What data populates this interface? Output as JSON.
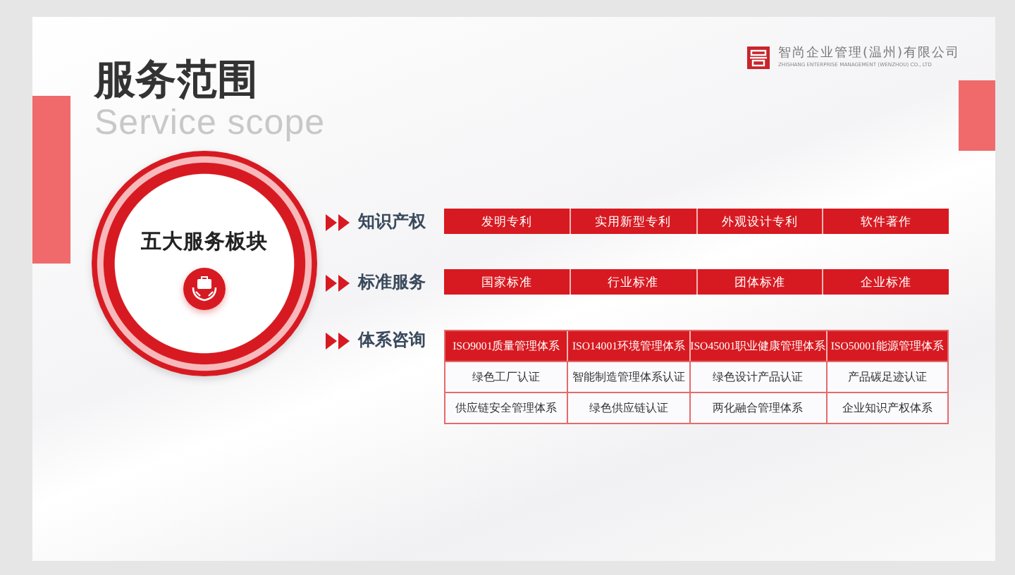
{
  "header": {
    "title": "服务范围",
    "subtitle": "Service scope"
  },
  "company": {
    "name": "智尚企业管理(温州)有限公司",
    "name_en": "ZHISHANG ENTERPRISE MANAGEMENT (WENZHOU) CO., LTD"
  },
  "hub": {
    "label": "五大服务板块"
  },
  "sections": [
    {
      "title": "知识产权",
      "kind": "strip",
      "items": [
        "发明专利",
        "实用新型专利",
        "外观设计专利",
        "软件著作"
      ]
    },
    {
      "title": "标准服务",
      "kind": "strip",
      "items": [
        "国家标准",
        "行业标准",
        "团体标准",
        "企业标准"
      ]
    },
    {
      "title": "体系咨询",
      "kind": "grid",
      "header": [
        "ISO9001质量管理体系",
        "ISO14001环境管理体系",
        "ISO45001职业健康管理体系",
        "ISO50001能源管理体系"
      ],
      "rows": [
        [
          "绿色工厂认证",
          "智能制造管理体系认证",
          "绿色设计产品认证",
          "产品碳足迹认证"
        ],
        [
          "供应链安全管理体系",
          "绿色供应链认证",
          "两化融合管理体系",
          "企业知识产权体系"
        ]
      ]
    }
  ]
}
